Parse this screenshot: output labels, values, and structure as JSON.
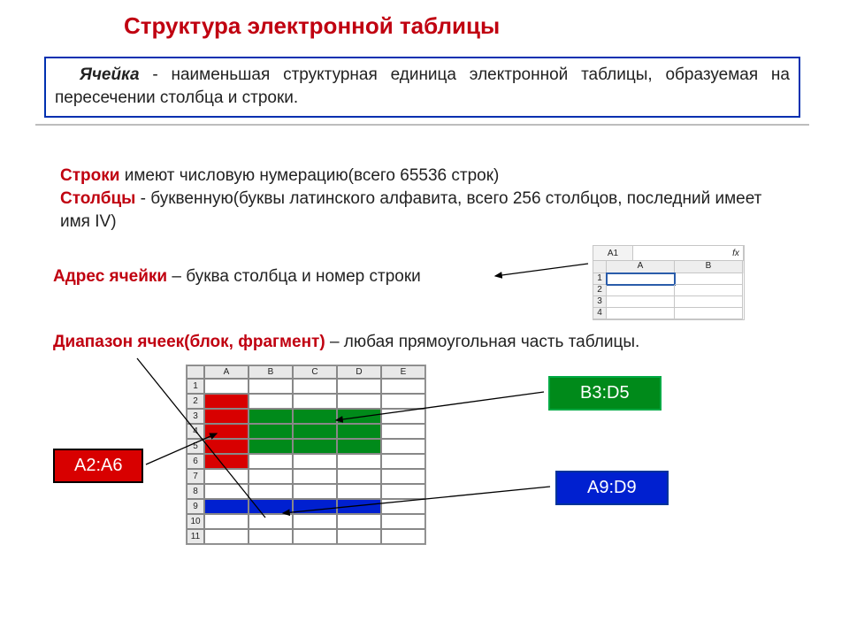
{
  "title": "Структура электронной таблицы",
  "definition": {
    "term": "Ячейка",
    "text": " - наименьшая структурная единица электронной  таблицы, образуемая на пересечении столбца и строки."
  },
  "rows_line": {
    "label": "Строки",
    "text": " имеют числовую нумерацию(всего 65536 строк)"
  },
  "cols_line": {
    "label": "Столбцы",
    "text": " - буквенную(буквы латинского алфавита, всего 256 столбцов, последний имеет имя IV)"
  },
  "addr_line": {
    "label": "Адрес ячейки",
    "text": " – буква столбца и номер строки"
  },
  "range_line": {
    "label": "Диапазон ячеек(блок, фрагмент)",
    "text": " – любая прямоугольная  часть таблицы."
  },
  "mini": {
    "namebox": "A1",
    "fx": "fx",
    "cols": [
      "A",
      "B"
    ],
    "rows": [
      "1",
      "2",
      "3",
      "4"
    ]
  },
  "sheet": {
    "cols": [
      "A",
      "B",
      "C",
      "D",
      "E"
    ],
    "rows": [
      "1",
      "2",
      "3",
      "4",
      "5",
      "6",
      "7",
      "8",
      "9",
      "10",
      "11"
    ]
  },
  "labels": {
    "a2a6": "A2:A6",
    "b3d5": "B3:D5",
    "a9d9": "A9:D9"
  },
  "chart_data": {
    "type": "table",
    "title": "Диапазоны ячеек",
    "ranges": [
      {
        "name": "A2:A6",
        "color": "#d80000",
        "cells": [
          "A2",
          "A3",
          "A4",
          "A5",
          "A6"
        ]
      },
      {
        "name": "B3:D5",
        "color": "#008a1a",
        "cells": [
          "B3",
          "C3",
          "D3",
          "B4",
          "C4",
          "D4",
          "B5",
          "C5",
          "D5"
        ]
      },
      {
        "name": "A9:D9",
        "color": "#0020d0",
        "cells": [
          "A9",
          "B9",
          "C9",
          "D9"
        ]
      }
    ],
    "columns": [
      "A",
      "B",
      "C",
      "D",
      "E"
    ],
    "row_count": 11
  }
}
